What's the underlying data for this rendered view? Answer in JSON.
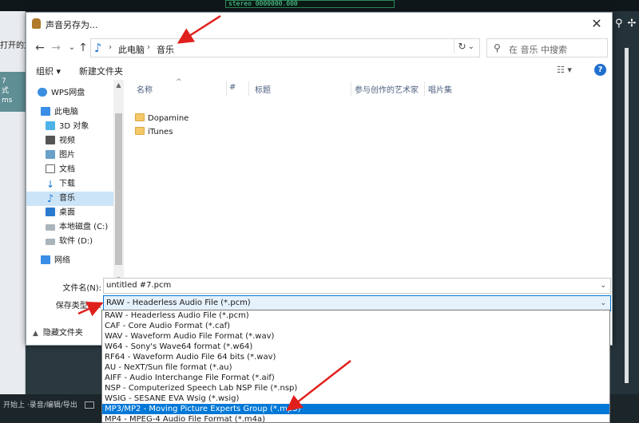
{
  "background_app": {
    "lcd_text": "stereo",
    "lcd_digits": "0000000.000",
    "left_text_1": "打开的文",
    "left_block_num": "7",
    "left_block_l2": "式",
    "left_block_l3": "ms",
    "bottom_text": "开始上  ·录音/编辑/导出"
  },
  "dialog": {
    "title": "声音另存为...",
    "close_glyph": "✕",
    "nav": {
      "back_glyph": "←",
      "forward_glyph": "→",
      "recent_glyph": "⌄",
      "up_glyph": "↑",
      "breadcrumb": [
        "此电脑",
        "音乐"
      ],
      "search_placeholder": "在 音乐 中搜索"
    },
    "toolbar": {
      "organize": "组织 ▾",
      "new_folder": "新建文件夹",
      "view_glyph": "☷ ▾",
      "help_glyph": "?"
    },
    "nav_pane": [
      {
        "label": "WPS网盘",
        "icon": "cloud-icon"
      },
      {
        "label": "此电脑",
        "icon": "computer-icon"
      },
      {
        "label": "3D 对象",
        "icon": "3d-objects-icon"
      },
      {
        "label": "视频",
        "icon": "video-icon"
      },
      {
        "label": "图片",
        "icon": "pictures-icon"
      },
      {
        "label": "文档",
        "icon": "documents-icon"
      },
      {
        "label": "下载",
        "icon": "download-icon"
      },
      {
        "label": "音乐",
        "icon": "music-icon",
        "selected": true
      },
      {
        "label": "桌面",
        "icon": "desktop-icon"
      },
      {
        "label": "本地磁盘 (C:)",
        "icon": "drive-icon"
      },
      {
        "label": "软件 (D:)",
        "icon": "drive-icon"
      },
      {
        "label": "网络",
        "icon": "network-icon"
      }
    ],
    "columns": [
      "名称",
      "#",
      "标题",
      "参与创作的艺术家",
      "唱片集"
    ],
    "files": [
      "Dopamine",
      "iTunes"
    ],
    "filename_label": "文件名(N):",
    "filename_value": "untitled #7.pcm",
    "savetype_label": "保存类型(T):",
    "savetype_value": "RAW - Headerless Audio File (*.pcm)",
    "hide_folders": "隐藏文件夹"
  },
  "dropdown_options": [
    "RAW - Headerless Audio File (*.pcm)",
    "CAF - Core Audio Format (*.caf)",
    "WAV - Waveform Audio File Format (*.wav)",
    "W64 - Sony's Wave64 format (*.w64)",
    "RF64 - Waveform Audio File 64 bits (*.wav)",
    "AU - NeXT/Sun file format (*.au)",
    "AIFF - Audio Interchange File Format (*.aif)",
    "NSP - Computerized Speech Lab NSP File (*.nsp)",
    "WSIG - SESANE EVA Wsig (*.wsig)",
    "MP3/MP2 - Moving Picture Experts Group (*.mp3)",
    "MP4 - MPEG-4 Audio File Format (*.m4a)"
  ],
  "highlighted_option_index": 9,
  "colors": {
    "accent": "#0078d7",
    "selection": "#cce4f7",
    "annotation_arrow": "#e0201c"
  }
}
